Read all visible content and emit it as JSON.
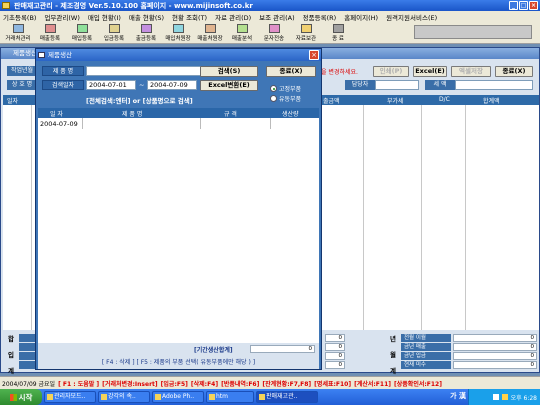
{
  "app": {
    "title": "판매재고관리 - 제조경영 Ver.5.10.100 홈페이지 - www.mijinsoft.co.kr"
  },
  "menu": [
    "기초등록(B)",
    "업무관리(W)",
    "매입 현황(I)",
    "매출 현황(S)",
    "현황 조회(T)",
    "자료 관리(D)",
    "보조 관리(A)",
    "정품등록(R)",
    "홈페이지(H)",
    "원격지원서비스(E)"
  ],
  "toolbar": [
    "거래처관리",
    "매출등록",
    "매입등록",
    "입금등록",
    "출금등록",
    "매입처원장",
    "매출처원장",
    "매출분석",
    "문자전송",
    "자료보관",
    "종 료"
  ],
  "background": {
    "title": "제품생산",
    "row1_label": "작업년월",
    "row2_label": "상 호 명",
    "hint": "을 변경하세요.",
    "buttons": {
      "print": "인쇄(P)",
      "excel": "Excel(E)",
      "disabled": "엑셀저장",
      "close": "종료(X)"
    },
    "manager_label": "담당자",
    "tax_label": "세 액",
    "columns": [
      "일자",
      "출금액",
      "부가세",
      "D/C",
      "합계액"
    ],
    "summary_left": [
      "합",
      "입",
      "계"
    ],
    "summary_labels": [
      "전월 이월",
      "금년 매출",
      "금년 입금",
      "현재 미수"
    ],
    "summary_values": [
      "0",
      "0",
      "0",
      "0"
    ],
    "summary_side_right": [
      "년",
      "월",
      "계"
    ],
    "left_summary_values": [
      "0",
      "0",
      "0",
      "0"
    ]
  },
  "dialog": {
    "title": "제품생산",
    "product_label": "제 품 명",
    "product_value": "",
    "date_label": "검색일자",
    "date_from": "2004-07-01",
    "date_sep": "~",
    "date_to": "2004-07-09",
    "search_button": "검색(S)",
    "excel_button": "Excel변환(E)",
    "close_button": "종료(X)",
    "radio_fixed": "고정부품",
    "radio_variable": "유동부품",
    "search_hint": "[전체검색:엔터] or [상품명으로 검색]",
    "columns": [
      "일 자",
      "제 품 명",
      "규 격",
      "생산량"
    ],
    "rows": [
      {
        "date": "2004-07-09"
      }
    ],
    "period_total_label": "[기간생산합계]",
    "period_total_value": "0",
    "help_text": "[ F4 : 삭제 ] [ F5 : 제품의 부품 선택( 유동부품에만 해당 ) ]"
  },
  "status": {
    "date": "2004/07/09 금요일",
    "hotkeys": [
      "F1 : 도움말",
      "거래처변경:Insert",
      "입금:F5",
      "삭제:F4",
      "반품내역:F6",
      "잔계현황:F7,F8",
      "명세표:F10",
      "계산서:F11",
      "상품확인서:F12"
    ]
  },
  "taskbar": {
    "start": "시작",
    "items": [
      "관리자모드..",
      "강각의 속..",
      "Adobe Ph..",
      "htm",
      "판매재고관.."
    ],
    "lang": "가 漢",
    "clock": "오후 6:28"
  }
}
